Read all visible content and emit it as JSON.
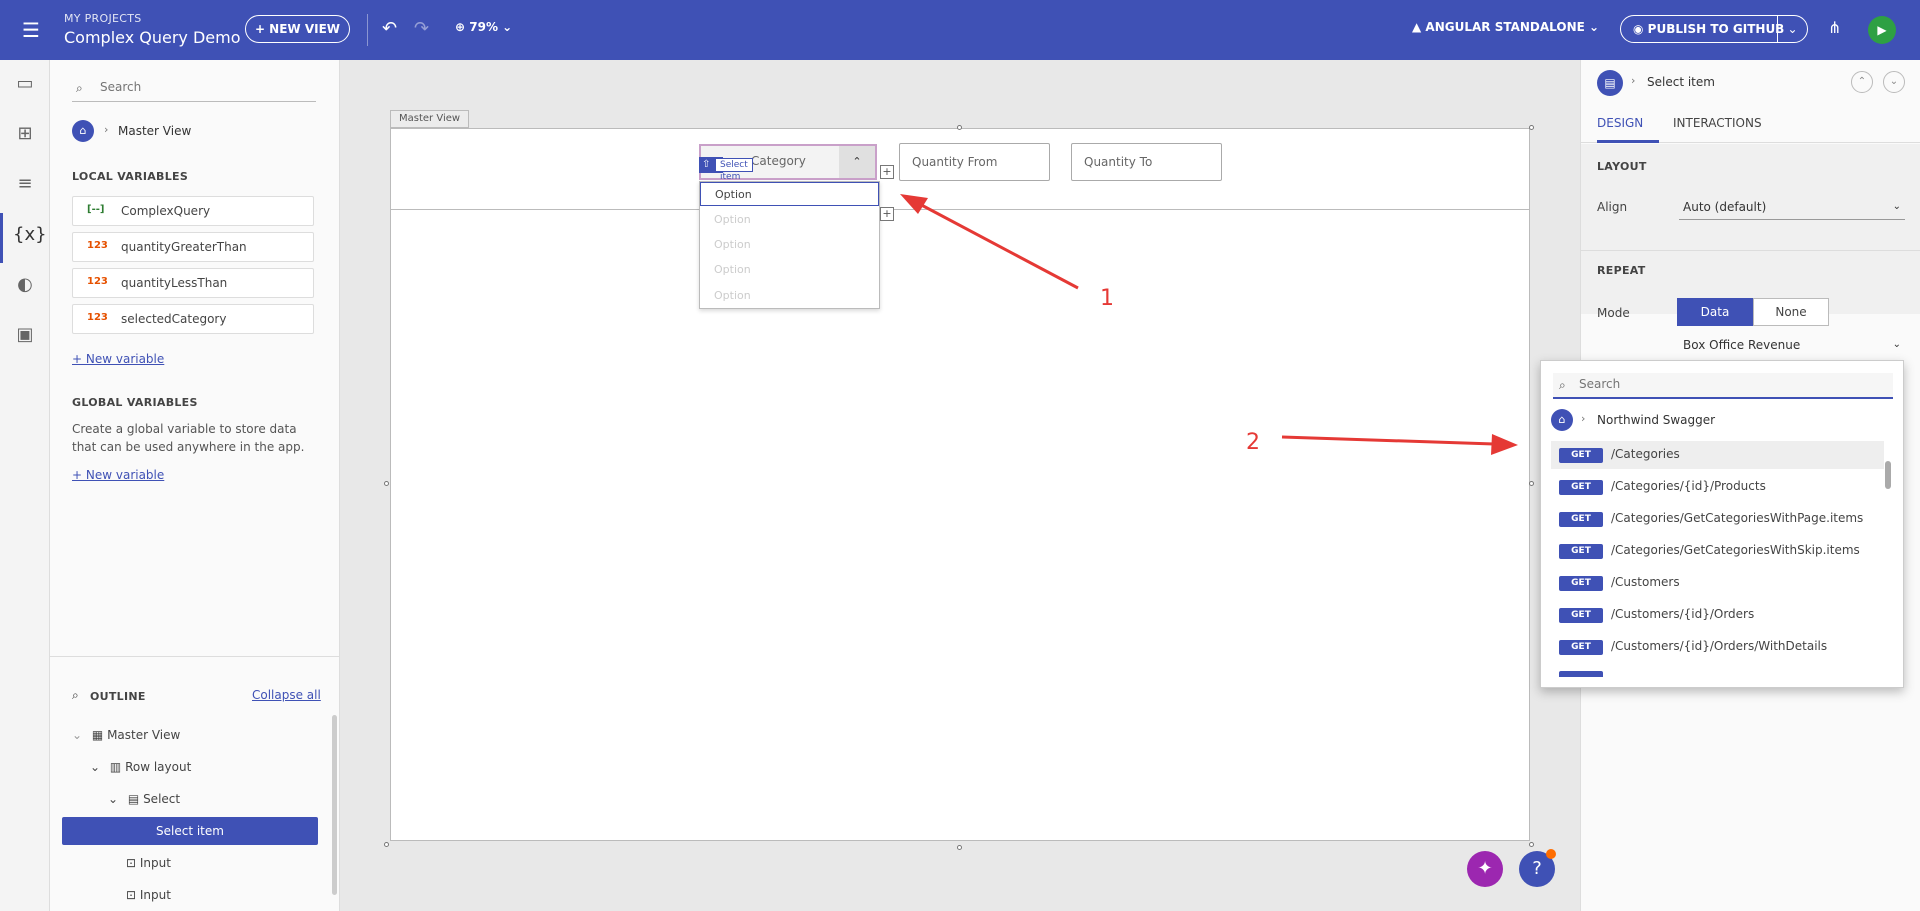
{
  "header": {
    "project_label": "MY PROJECTS",
    "project_title": "Complex Query Demo",
    "new_view_label": "+ NEW VIEW",
    "zoom": "79%",
    "framework": "ANGULAR STANDALONE",
    "publish_label": "PUBLISH TO GITHUB"
  },
  "left_panel": {
    "search_placeholder": "Search",
    "breadcrumb": "Master View",
    "local_vars_title": "LOCAL VARIABLES",
    "local_vars": [
      {
        "icon": "[--]",
        "name": "ComplexQuery",
        "color": "#2e7d32"
      },
      {
        "icon": "123",
        "name": "quantityGreaterThan",
        "color": "#e65100"
      },
      {
        "icon": "123",
        "name": "quantityLessThan",
        "color": "#e65100"
      },
      {
        "icon": "123",
        "name": "selectedCategory",
        "color": "#e65100"
      }
    ],
    "new_variable": "+ New variable",
    "global_vars_title": "GLOBAL VARIABLES",
    "global_desc": "Create a global variable to store data that can be used anywhere in the app.",
    "new_variable_global": "+ New variable",
    "outline_title": "OUTLINE",
    "collapse_all": "Collapse all",
    "tree": {
      "master_view": "Master View",
      "row_layout": "Row layout",
      "select": "Select",
      "select_item": "Select item",
      "input1": "Input",
      "input2": "Input"
    }
  },
  "canvas": {
    "tag": "Master View",
    "select_text": "Category",
    "select_badge": "Select item",
    "options": [
      "Option",
      "Option",
      "Option",
      "Option",
      "Option"
    ],
    "quantity_from": "Quantity From",
    "quantity_to": "Quantity To",
    "annot1": "1",
    "annot2": "2"
  },
  "right_panel": {
    "breadcrumb": "Select item",
    "tab_design": "DESIGN",
    "tab_interactions": "INTERACTIONS",
    "layout_title": "LAYOUT",
    "align_label": "Align",
    "align_value": "Auto (default)",
    "repeat_title": "REPEAT",
    "mode_label": "Mode",
    "mode_data": "Data",
    "mode_none": "None",
    "data_source": "Box Office Revenue"
  },
  "endpoint_popup": {
    "search_placeholder": "Search",
    "source": "Northwind Swagger",
    "method": "GET",
    "endpoints": [
      "/Categories",
      "/Categories/{id}/Products",
      "/Categories/GetCategoriesWithPage.items",
      "/Categories/GetCategoriesWithSkip.items",
      "/Customers",
      "/Customers/{id}/Orders",
      "/Customers/{id}/Orders/WithDetails"
    ]
  },
  "colors": {
    "brand": "#3f51b5",
    "run": "#2ea043",
    "annotation": "#e53935"
  }
}
